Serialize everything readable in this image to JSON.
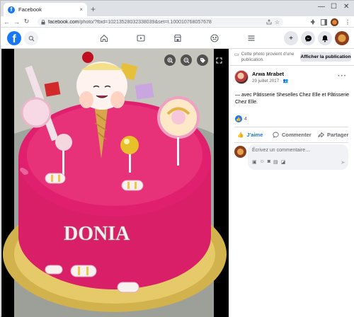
{
  "browser": {
    "tab_title": "Facebook",
    "tab_favicon": "f",
    "tab_close": "×",
    "new_tab": "+",
    "window_controls": {
      "minimize": "—",
      "maximize": "☐",
      "close": "✕"
    },
    "nav": {
      "back": "←",
      "forward": "→",
      "reload": "↻"
    },
    "url_host": "facebook.com",
    "url_rest": "/photo/?fbid=10213528032338039&set=t.100010768057678",
    "toolbar_icons": [
      "share-icon",
      "star-icon",
      "extensions-icon",
      "sidepanel-icon",
      "profile-icon",
      "menu-icon"
    ]
  },
  "fb_header": {
    "logo": "f",
    "nav_icons": [
      "home-icon",
      "watch-icon",
      "marketplace-icon",
      "groups-icon",
      "menu-icon"
    ],
    "right_icons": [
      "create-icon",
      "messenger-icon",
      "notifications-icon",
      "account-icon"
    ]
  },
  "photo": {
    "cake_name": "DONIA",
    "overlay_icons": [
      "zoom-in-icon",
      "zoom-out-icon",
      "tag-icon",
      "fullscreen-icon"
    ]
  },
  "sidebar": {
    "notice": "Cette photo provient d'une publication.",
    "show_publication": "Afficher la publication",
    "author": "Arwa Mrabet",
    "date": "29 juillet 2017 · 👥",
    "more": "···",
    "caption": "— avec Pâtisserie Sheselles Chez Elle et Pâtisserie Chez Elle.",
    "reaction_count": "4",
    "actions": {
      "like": "J'aime",
      "comment": "Commenter",
      "share": "Partager"
    },
    "comment_placeholder": "Écrivez un commentaire…"
  },
  "colors": {
    "accent": "#1877f2",
    "cake_pink": "#e0206e",
    "gold": "#d8b24a"
  }
}
